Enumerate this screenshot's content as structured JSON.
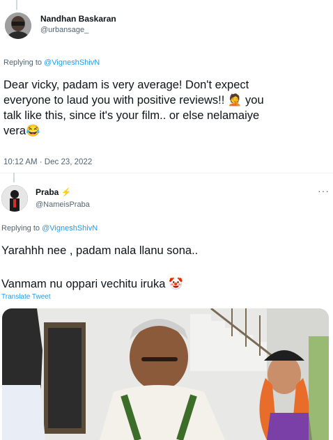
{
  "tweet1": {
    "name": "Nandhan Baskaran",
    "handle": "@urbansage_",
    "replying_prefix": "Replying to ",
    "replying_to": "@VigneshShivN",
    "line1": "Dear vicky, padam is very average! Don't expect",
    "line2": "everyone to laud you with positive reviews!!",
    "line2_emoji": "🤦",
    "line2_tail": " you",
    "line3": "talk like this, since it's your film.. or else nelamaiye",
    "line4": "vera",
    "line4_emoji": "😂",
    "timestamp": "10:12 AM · Dec 23, 2022"
  },
  "tweet2": {
    "name": "Praba",
    "name_emoji": "⚡",
    "handle": "@NameisPraba",
    "more": "···",
    "replying_prefix": "Replying to ",
    "replying_to": "@VigneshShivN",
    "line1": "Yarahhh nee , padam nala llanu sona..",
    "line2": "Vanmam nu oppari vechitu iruka",
    "line2_emoji": "🤡",
    "translate": "Translate Tweet"
  },
  "colors": {
    "link": "#1d9bf0",
    "secondary_text": "#536471",
    "primary_text": "#0f1419"
  }
}
